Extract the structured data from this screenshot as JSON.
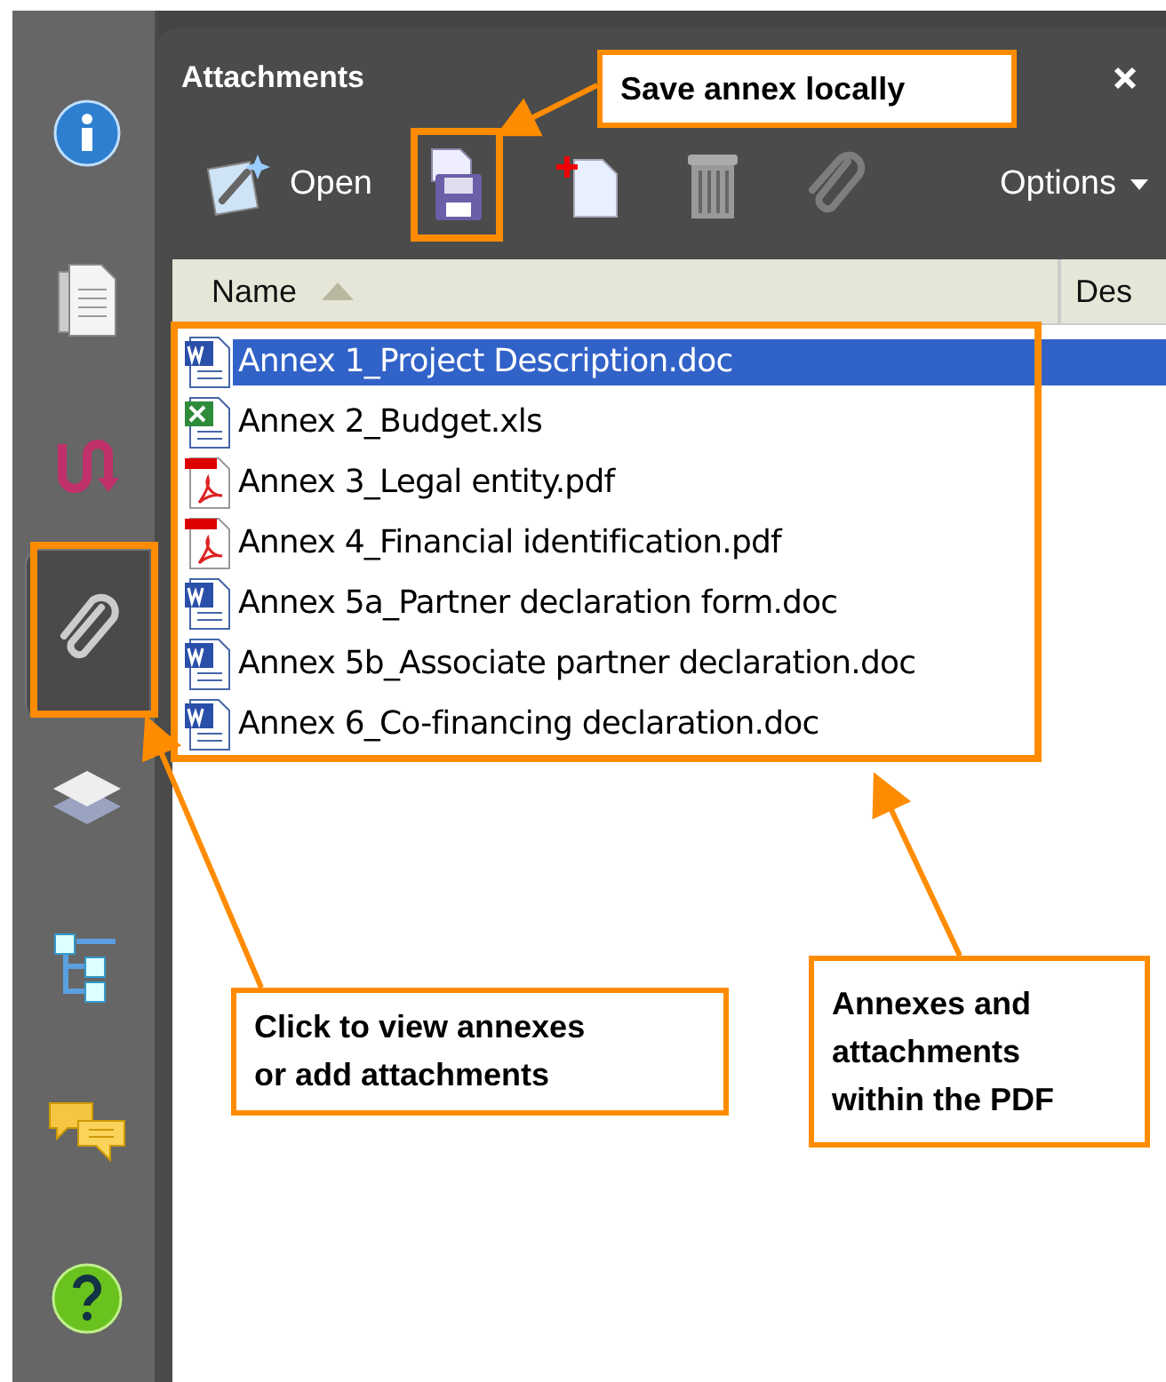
{
  "sidebar": {
    "items": [
      {
        "kind": "info",
        "selected": false
      },
      {
        "kind": "pages",
        "selected": false
      },
      {
        "kind": "signatures",
        "selected": false
      },
      {
        "kind": "attachments",
        "selected": true
      },
      {
        "kind": "layers",
        "selected": false
      },
      {
        "kind": "tree",
        "selected": false
      },
      {
        "kind": "comments",
        "selected": false
      },
      {
        "kind": "help",
        "selected": false
      }
    ]
  },
  "panel": {
    "title": "Attachments",
    "toolbar": [
      {
        "kind": "open",
        "label": "Open",
        "disabled": false
      },
      {
        "kind": "save",
        "disabled": false
      },
      {
        "kind": "add",
        "disabled": false
      },
      {
        "kind": "delete",
        "disabled": false
      },
      {
        "kind": "clip",
        "disabled": true
      }
    ],
    "options": "Options"
  },
  "table": {
    "columns": [
      {
        "label": "Name",
        "sorted": true
      },
      {
        "label": "Des",
        "sorted": false
      }
    ],
    "rows": [
      {
        "name": "Annex 1_Project Description.doc",
        "kind": "doc",
        "selected": true
      },
      {
        "name": "Annex 2_Budget.xls",
        "kind": "xls",
        "selected": false
      },
      {
        "name": "Annex 3_Legal entity.pdf",
        "kind": "pdf",
        "selected": false
      },
      {
        "name": "Annex 4_Financial identification.pdf",
        "kind": "pdf",
        "selected": false
      },
      {
        "name": "Annex 5a_Partner declaration form.doc",
        "kind": "doc",
        "selected": false
      },
      {
        "name": "Annex 5b_Associate partner declaration.doc",
        "kind": "doc",
        "selected": false
      },
      {
        "name": "Annex 6_Co-financing declaration.doc",
        "kind": "doc",
        "selected": false
      }
    ]
  },
  "callouts": [
    {
      "text": "Save annex locally"
    },
    {
      "text": "Click to view annexes\nor add attachments"
    },
    {
      "text": "Annexes and\nattachments\nwithin the PDF"
    }
  ]
}
